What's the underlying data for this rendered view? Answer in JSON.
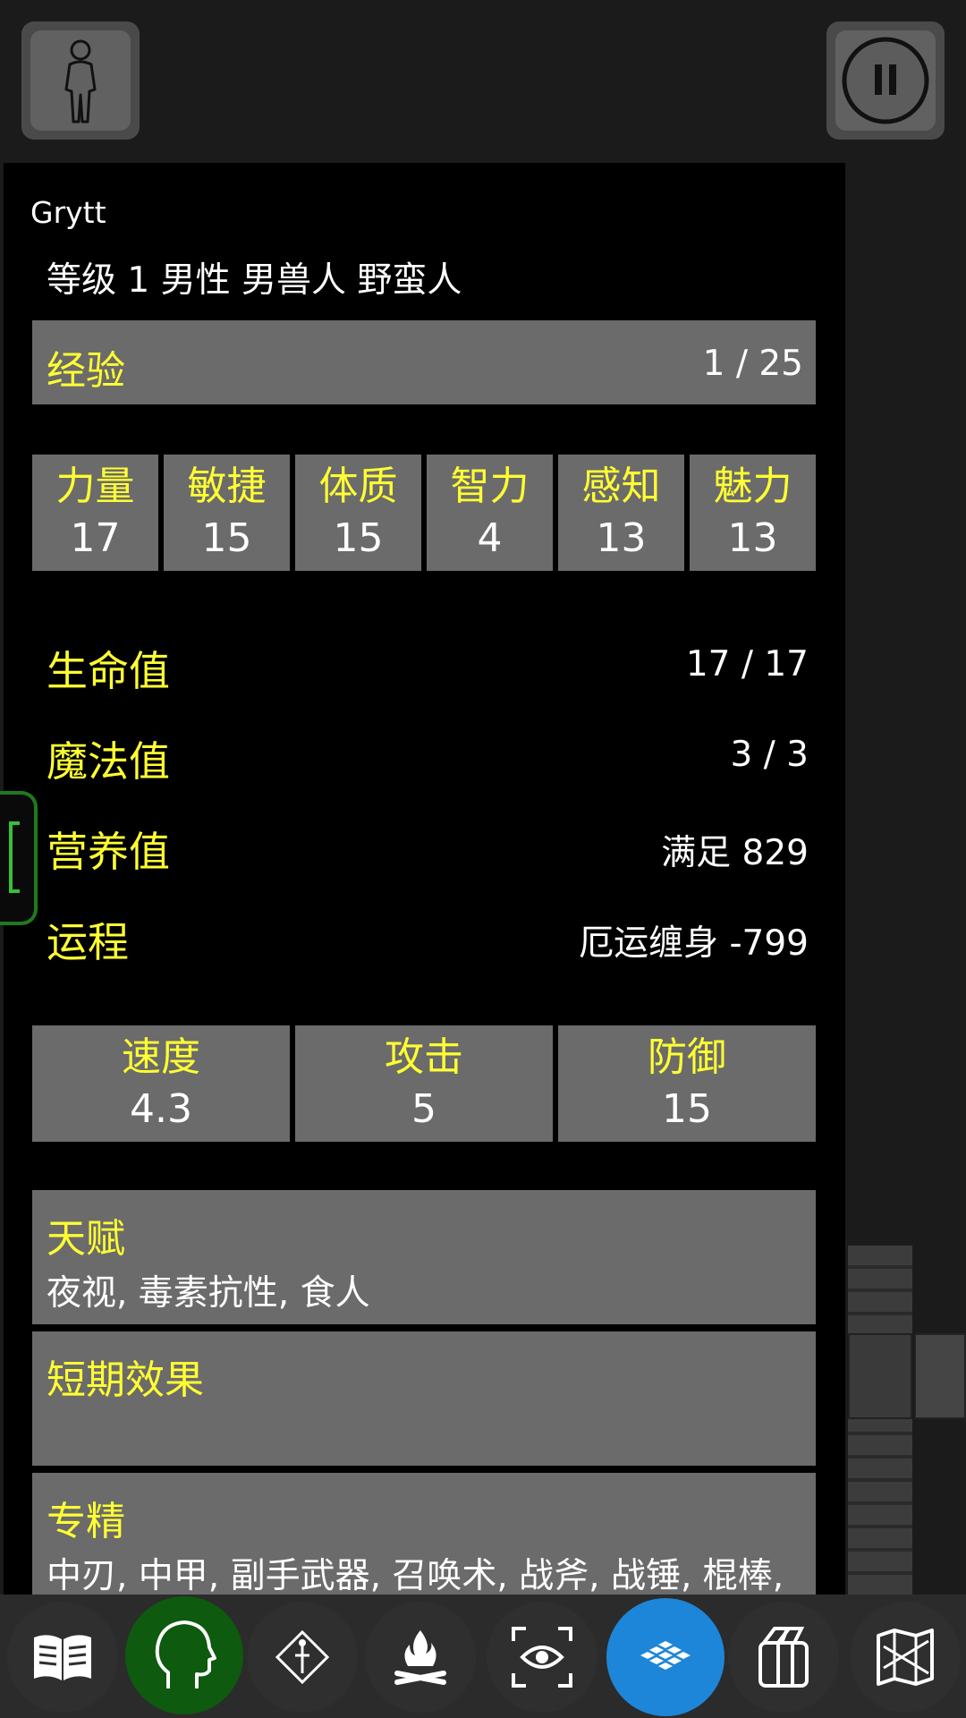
{
  "character": {
    "name": "Grytt",
    "description": "等级 1 男性 男兽人 野蛮人"
  },
  "experience": {
    "label": "经验",
    "value": "1 / 25"
  },
  "attributes": [
    {
      "name": "力量",
      "value": "17"
    },
    {
      "name": "敏捷",
      "value": "15"
    },
    {
      "name": "体质",
      "value": "15"
    },
    {
      "name": "智力",
      "value": "4"
    },
    {
      "name": "感知",
      "value": "13"
    },
    {
      "name": "魅力",
      "value": "13"
    }
  ],
  "vitals": [
    {
      "name": "生命值",
      "value": "17 / 17"
    },
    {
      "name": "魔法值",
      "value": "3 / 3"
    },
    {
      "name": "营养值",
      "value": "满足 829"
    },
    {
      "name": "运程",
      "value": "厄运缠身 -799"
    }
  ],
  "combat": [
    {
      "name": "速度",
      "value": "4.3"
    },
    {
      "name": "攻击",
      "value": "5"
    },
    {
      "name": "防御",
      "value": "15"
    }
  ],
  "talents": {
    "title": "天赋",
    "text": "夜视, 毒素抗性, 食人"
  },
  "short_effects": {
    "title": "短期效果",
    "text": ""
  },
  "proficiencies": {
    "title": "专精",
    "text": "中刃, 中甲, 副手武器, 召唤术, 战斧, 战锤, 棍棒,"
  },
  "bottom_bar": [
    "journal-icon",
    "character-head-icon",
    "skill-diamond-icon",
    "campfire-icon",
    "look-eye-icon",
    "map-grid-icon",
    "inventory-bag-icon",
    "dungeon-map-icon"
  ],
  "colors": {
    "label": "#ffff33",
    "box": "#6b6b6b",
    "active_green": "#0e5a0e",
    "active_blue": "#1e86d8"
  }
}
